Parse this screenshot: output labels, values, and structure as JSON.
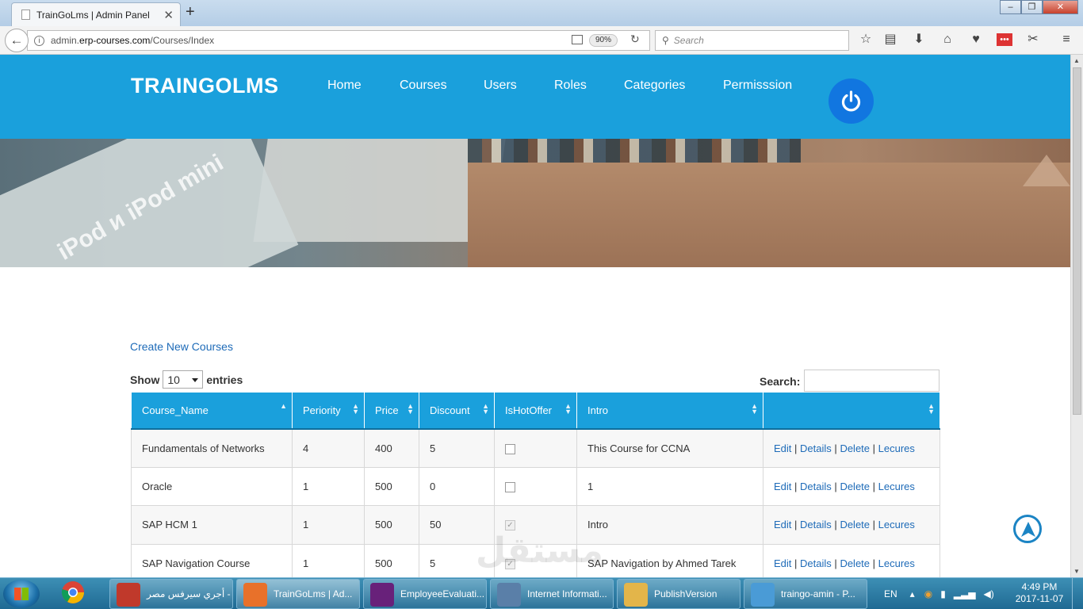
{
  "browser": {
    "tab_title": "TrainGoLms | Admin Panel",
    "url_prefix": "admin.",
    "url_domain": "erp-courses.com",
    "url_path": "/Courses/Index",
    "zoom": "90%",
    "search_placeholder": "Search"
  },
  "header": {
    "brand": "TRAINGOLMS",
    "nav": [
      "Home",
      "Courses",
      "Users",
      "Roles",
      "Categories",
      "Permisssion"
    ]
  },
  "hero": {
    "book_text": "iPod и iPod mini"
  },
  "content": {
    "create_link": "Create New Courses",
    "show_label": "Show",
    "entries_value": "10",
    "entries_label": "entries",
    "search_label": "Search:"
  },
  "table": {
    "columns": [
      "Course_Name",
      "Periority",
      "Price",
      "Discount",
      "IsHotOffer",
      "Intro",
      ""
    ],
    "rows": [
      {
        "name": "Fundamentals of Networks",
        "periority": "4",
        "price": "400",
        "discount": "5",
        "hot": false,
        "intro": "This Course for CCNA"
      },
      {
        "name": "Oracle",
        "periority": "1",
        "price": "500",
        "discount": "0",
        "hot": false,
        "intro": "1"
      },
      {
        "name": "SAP HCM 1",
        "periority": "1",
        "price": "500",
        "discount": "50",
        "hot": true,
        "intro": "Intro"
      },
      {
        "name": "SAP Navigation Course",
        "periority": "1",
        "price": "500",
        "discount": "5",
        "hot": true,
        "intro": "SAP Navigation by Ahmed Tarek"
      }
    ],
    "actions": [
      "Edit",
      "Details",
      "Delete",
      "Lecures"
    ]
  },
  "watermark": "مستقل",
  "taskbar": {
    "items": [
      {
        "label": "أجري سيرفس مصر - ...",
        "color": "#c0392b"
      },
      {
        "label": "TrainGoLms | Ad...",
        "color": "#e8712a",
        "active": true
      },
      {
        "label": "EmployeeEvaluati...",
        "color": "#68217a"
      },
      {
        "label": "Internet Informati...",
        "color": "#5a7fa8"
      },
      {
        "label": "PublishVersion",
        "color": "#e3b54a"
      },
      {
        "label": "traingo-amin - P...",
        "color": "#4a9bd6"
      }
    ],
    "lang": "EN",
    "time": "4:49 PM",
    "date": "2017-11-07"
  },
  "colors": {
    "header_bg": "#1aa0dc",
    "power_button": "#1176e0",
    "link": "#1e6bb8"
  }
}
